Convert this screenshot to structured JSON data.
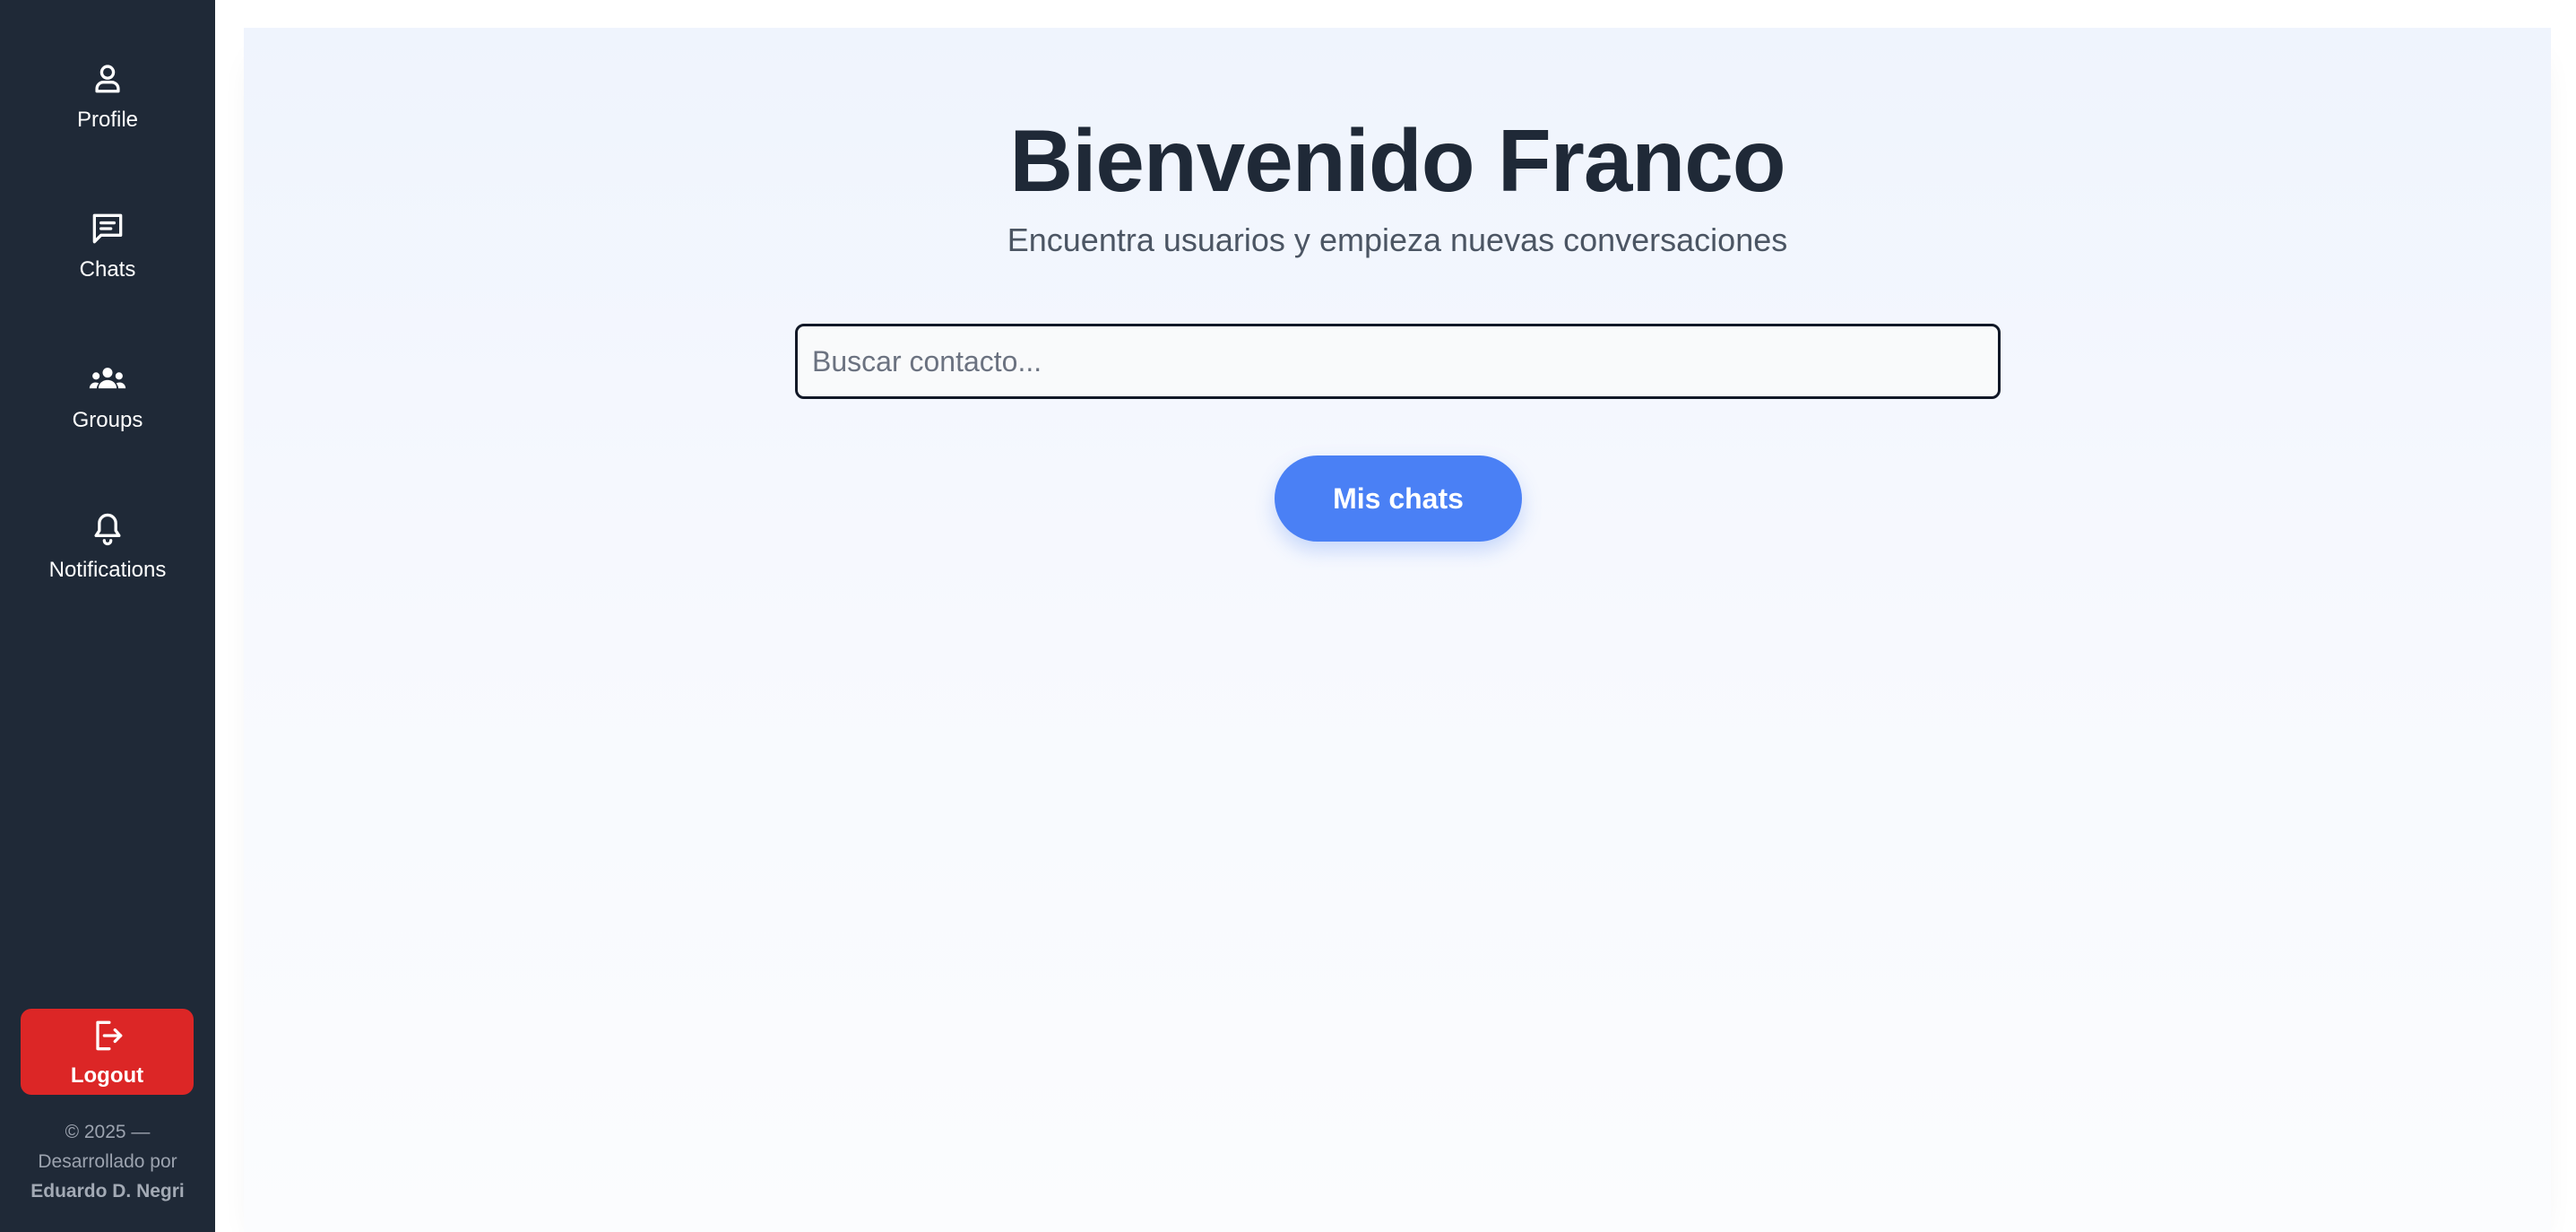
{
  "sidebar": {
    "items": [
      {
        "label": "Profile",
        "icon": "person-icon"
      },
      {
        "label": "Chats",
        "icon": "chat-icon"
      },
      {
        "label": "Groups",
        "icon": "group-icon"
      },
      {
        "label": "Notifications",
        "icon": "bell-icon"
      }
    ],
    "logout": {
      "label": "Logout",
      "icon": "logout-icon"
    },
    "footer": {
      "line1": "© 2025 —",
      "line2": "Desarrollado por",
      "author": "Eduardo D. Negri"
    }
  },
  "main": {
    "title": "Bienvenido Franco",
    "subtitle": "Encuentra usuarios y empieza nuevas conversaciones",
    "search": {
      "placeholder": "Buscar contacto...",
      "value": ""
    },
    "primary_button": "Mis chats"
  },
  "colors": {
    "sidebar_bg": "#1f2937",
    "logout_bg": "#dc2626",
    "accent": "#4a80f5",
    "title": "#1f2937"
  }
}
